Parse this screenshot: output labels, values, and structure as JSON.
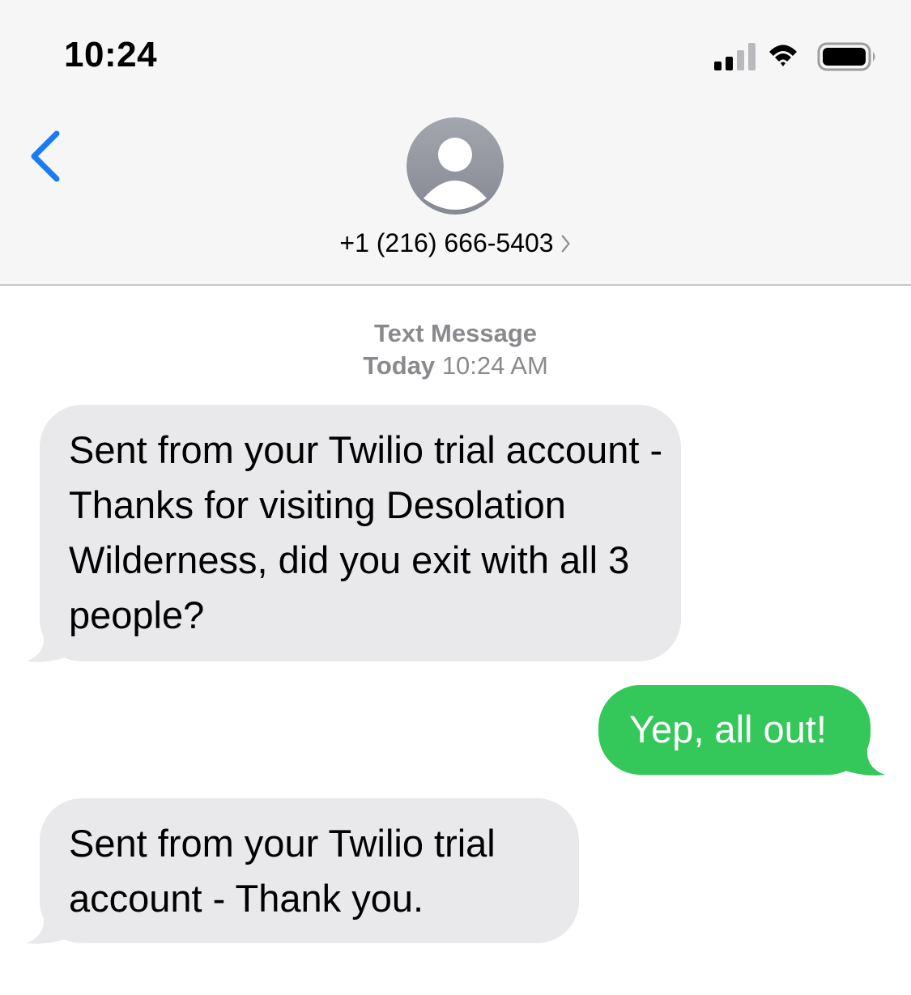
{
  "status_bar": {
    "time": "10:24",
    "icons": [
      "cellular-signal-icon",
      "wifi-icon",
      "battery-icon"
    ]
  },
  "nav": {
    "back_icon": "chevron-left-icon",
    "avatar_icon": "person-icon",
    "contact_number": "+1 (216) 666-5403",
    "contact_chevron_icon": "chevron-right-icon"
  },
  "thread": {
    "service_label": "Text Message",
    "day_label": "Today",
    "time_label": "10:24 AM",
    "messages": [
      {
        "direction": "incoming",
        "text": "Sent from your Twilio trial account - Thanks for visiting Desolation Wilderness, did you exit with all 3 people?"
      },
      {
        "direction": "outgoing",
        "text": "Yep, all out!"
      },
      {
        "direction": "incoming",
        "text": "Sent from your Twilio trial account - Thank you."
      }
    ]
  },
  "colors": {
    "accent_blue": "#1a7cf5",
    "incoming_bubble": "#e9e9eb",
    "outgoing_bubble": "#34c759",
    "header_bg": "#f6f6f6",
    "meta_gray": "#8a8a8e"
  }
}
